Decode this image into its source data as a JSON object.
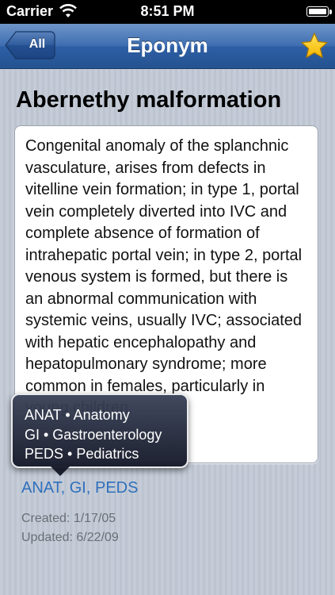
{
  "status_bar": {
    "carrier": "Carrier",
    "time": "8:51 PM",
    "icons": [
      "wifi-icon",
      "battery-icon"
    ]
  },
  "nav_bar": {
    "back_label": "All",
    "title": "Eponym",
    "favorite_icon": "star-icon",
    "accent_color": "#2e5fa6",
    "star_color": "#ffc61a"
  },
  "entry": {
    "title": "Abernethy malformation",
    "definition": "Congenital anomaly of the splanchnic vasculature, arises from defects in vitelline vein formation; in type 1, portal vein completely diverted into IVC and complete absence of formation of intrahepatic portal vein; in type 2, portal venous system is formed, but there is an abnormal communication with systemic veins, usually IVC; associated with hepatic encephalopathy and hepatopulmonary syndrome; more common in females, particularly in young children.",
    "tags_link": "ANAT, GI, PEDS",
    "link_color": "#2f6fbc",
    "created": "Created: 1/17/05",
    "updated": "Updated: 6/22/09"
  },
  "tooltip": {
    "items": [
      "ANAT • Anatomy",
      "GI • Gastroenterology",
      "PEDS • Pediatrics"
    ]
  }
}
